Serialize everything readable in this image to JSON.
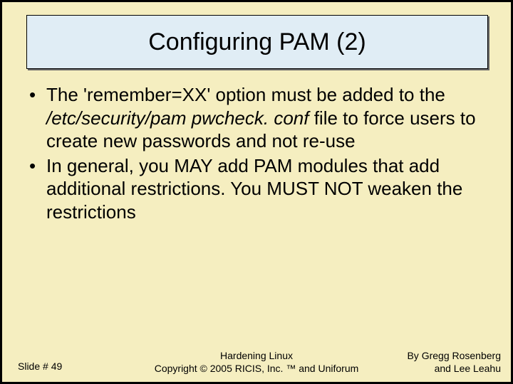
{
  "title": "Configuring PAM (2)",
  "bullets": [
    {
      "pre": "The 'remember=XX' option must be added to the ",
      "italic": "/etc/security/pam pwcheck. conf",
      "post": " file to force users to create new passwords and not re-use"
    },
    {
      "pre": "In general, you MAY add PAM modules that add additional restrictions. You MUST NOT weaken the restrictions",
      "italic": "",
      "post": ""
    }
  ],
  "footer": {
    "slide_label": "Slide # 49",
    "center_line1": "Hardening Linux",
    "center_line2": "Copyright © 2005 RICIS, Inc. ™ and Uniforum",
    "right_line1": "By Gregg Rosenberg",
    "right_line2": "and Lee Leahu"
  }
}
